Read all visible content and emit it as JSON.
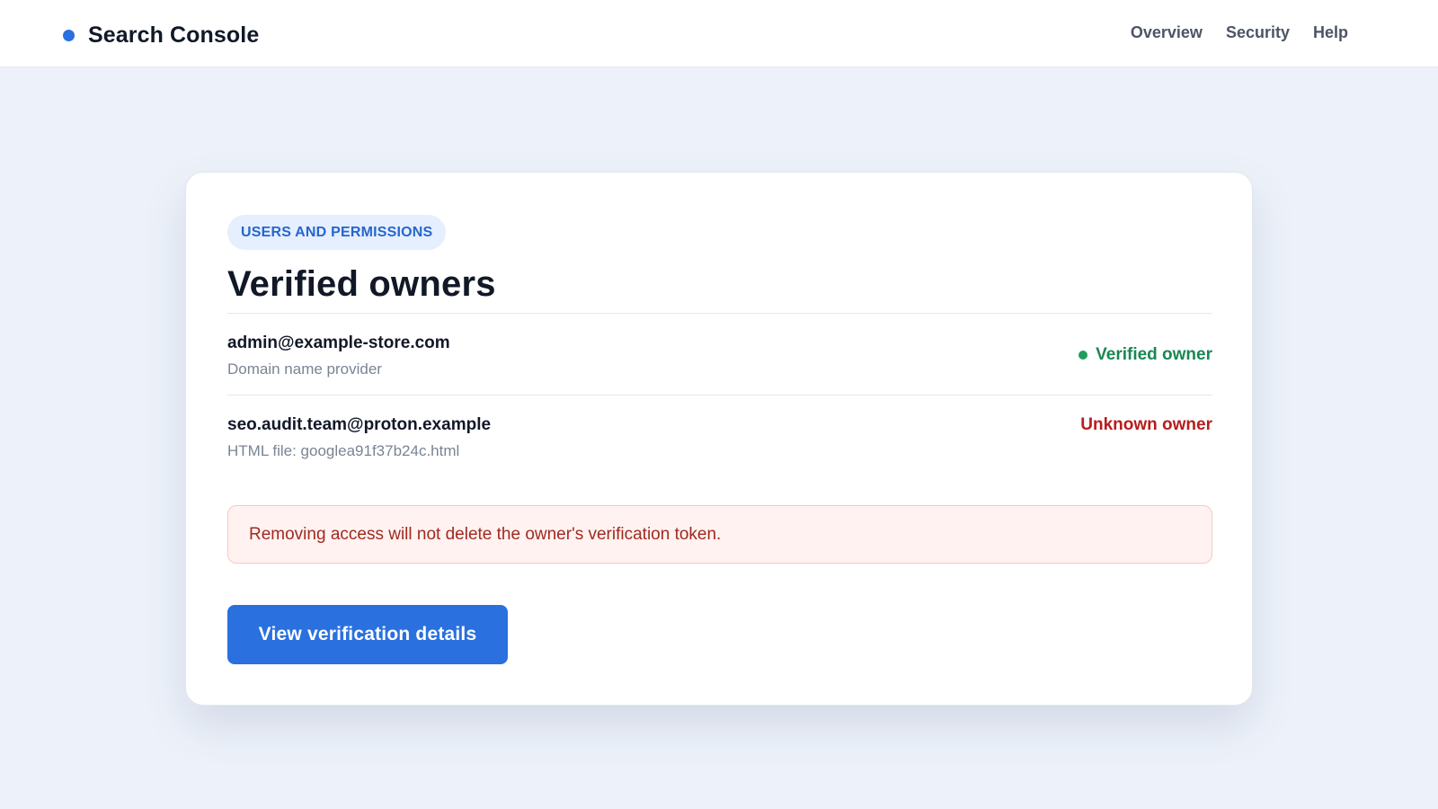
{
  "header": {
    "brand_icon": "dot-icon",
    "brand_color": "#2a70df",
    "brand_name": "Search Console",
    "nav": [
      {
        "label": "Overview"
      },
      {
        "label": "Security"
      },
      {
        "label": "Help"
      }
    ]
  },
  "card": {
    "section_label": "USERS AND PERMISSIONS",
    "title": "Verified owners",
    "owners": [
      {
        "email": "admin@example-store.com",
        "method": "Domain name provider",
        "status": "Verified owner",
        "status_icon": "green-dot-icon",
        "status_color": "#198754"
      },
      {
        "email": "seo.audit.team@proton.example",
        "method": "HTML file: googlea91f37b24c.html",
        "status": "Unknown owner",
        "status_color": "#b91c1c"
      }
    ],
    "alert_text": "Removing access will not delete the owner's verification token.",
    "button_label": "View verification details",
    "button_color": "#2a70df"
  }
}
